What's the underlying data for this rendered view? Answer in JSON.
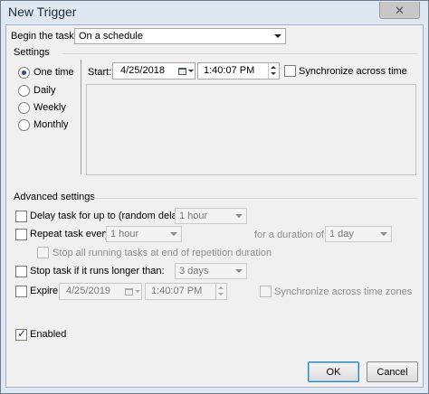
{
  "window": {
    "title": "New Trigger",
    "close_label": "✕"
  },
  "begin_task": {
    "label": "Begin the task:",
    "value": "On a schedule"
  },
  "settings": {
    "heading": "Settings",
    "radios": [
      {
        "label": "One time",
        "selected": true
      },
      {
        "label": "Daily",
        "selected": false
      },
      {
        "label": "Weekly",
        "selected": false
      },
      {
        "label": "Monthly",
        "selected": false
      }
    ],
    "start_label": "Start:",
    "start_date": "4/25/2018",
    "start_time": "1:40:07 PM",
    "sync_label": "Synchronize across time"
  },
  "advanced": {
    "heading": "Advanced settings",
    "delay": {
      "label": "Delay task for up to (random delay):",
      "value": "1 hour",
      "checked": false
    },
    "repeat": {
      "label": "Repeat task every:",
      "value": "1 hour",
      "checked": false,
      "duration_label": "for a duration of:",
      "duration_value": "1 day"
    },
    "stop_running": {
      "label": "Stop all running tasks at end of repetition duration",
      "checked": false
    },
    "stop_longer": {
      "label": "Stop task if it runs longer than:",
      "value": "3 days",
      "checked": false
    },
    "expire": {
      "label": "Expire:",
      "date": "4/25/2019",
      "time": "1:40:07 PM",
      "checked": false,
      "sync_label": "Synchronize across time zones"
    },
    "enabled": {
      "label": "Enabled",
      "checked": true,
      "check_glyph": "✓"
    }
  },
  "buttons": {
    "ok": "OK",
    "cancel": "Cancel"
  },
  "colors": {
    "title_bg": "#dfe7f0",
    "client_bg": "#f0f0f0",
    "ok_border": "#3c7fb1"
  }
}
